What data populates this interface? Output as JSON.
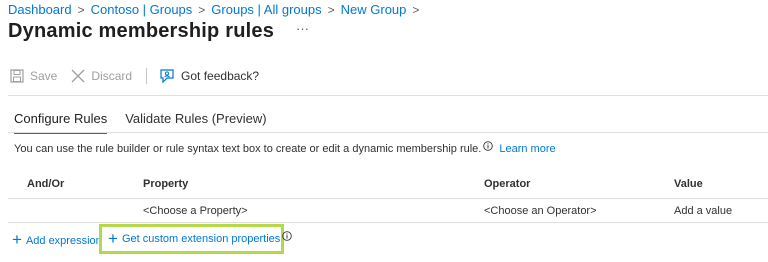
{
  "breadcrumb": {
    "items": [
      "Dashboard",
      "Contoso | Groups",
      "Groups | All groups",
      "New Group"
    ],
    "separator": ">"
  },
  "page": {
    "title": "Dynamic membership rules",
    "more_label": "···"
  },
  "toolbar": {
    "save_label": "Save",
    "discard_label": "Discard",
    "feedback_label": "Got feedback?"
  },
  "tabs": [
    {
      "label": "Configure Rules",
      "selected": true
    },
    {
      "label": "Validate Rules (Preview)",
      "selected": false
    }
  ],
  "description": {
    "text": "You can use the rule builder or rule syntax text box to create or edit a dynamic membership rule.",
    "learn_more": "Learn more"
  },
  "grid": {
    "columns": [
      "And/Or",
      "Property",
      "Operator",
      "Value"
    ],
    "rows": [
      {
        "and_or": "",
        "property": "<Choose a Property>",
        "operator": "<Choose an Operator>",
        "value": "Add a value"
      }
    ]
  },
  "actions": {
    "add_expression": "Add expression",
    "custom_extension": "Get custom extension properties"
  },
  "colors": {
    "accent": "#0078d4",
    "highlight_border": "#b4d84a",
    "disabled_text": "#a19f9d"
  },
  "icons": {
    "save": "save-icon",
    "discard": "close-icon",
    "feedback": "feedback-icon",
    "info": "info-icon",
    "add": "plus-icon"
  }
}
